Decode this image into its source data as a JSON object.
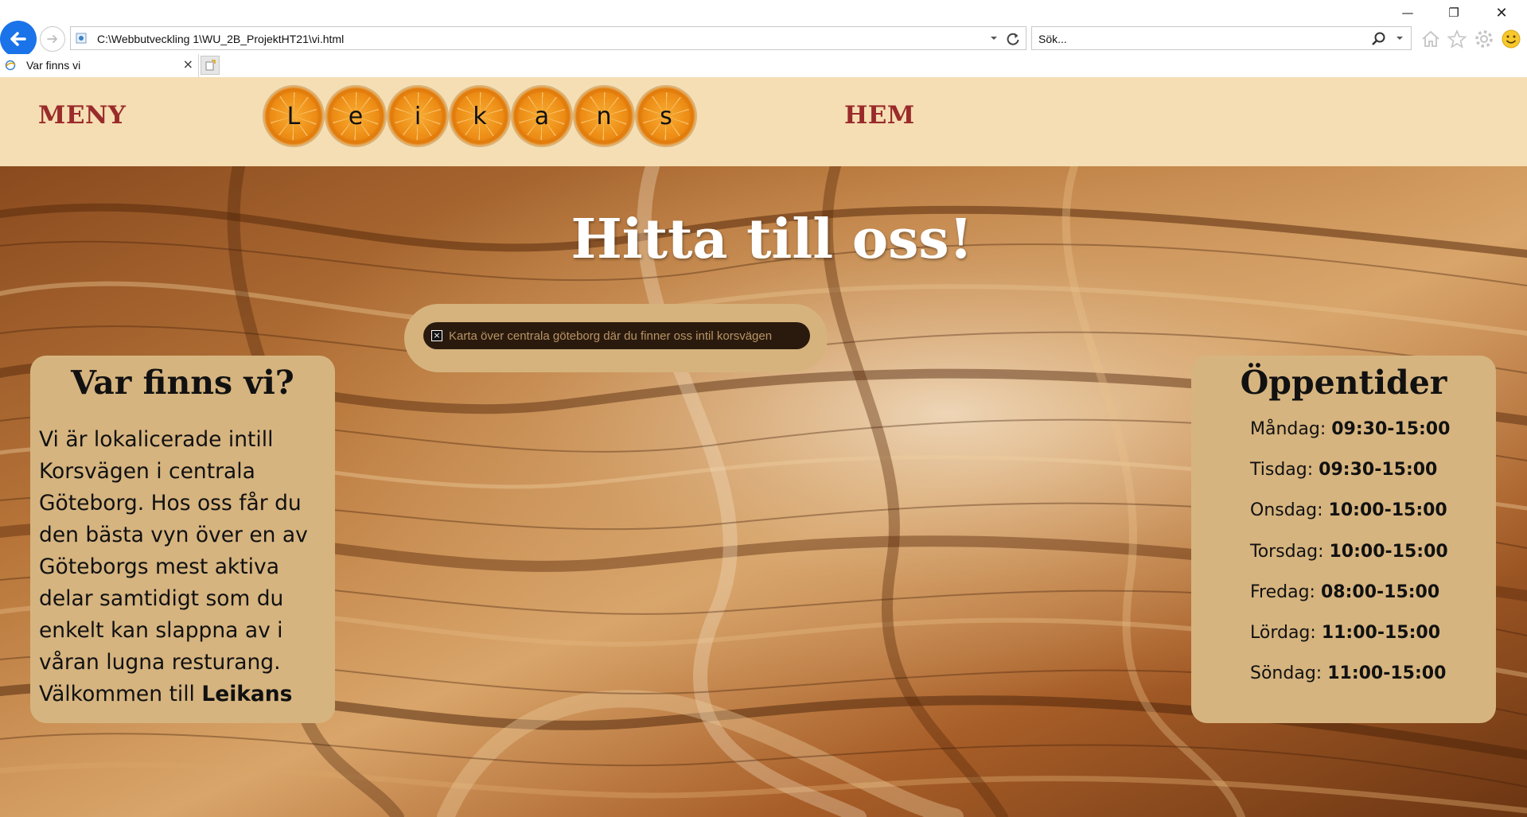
{
  "browser": {
    "address": "C:\\Webbutveckling 1\\WU_2B_ProjektHT21\\vi.html",
    "search_placeholder": "Sök...",
    "tab_title": "Var finns vi"
  },
  "header": {
    "menu_label": "MENY",
    "home_label": "HEM",
    "logo_letters": [
      "L",
      "e",
      "i",
      "k",
      "a",
      "n",
      "s"
    ]
  },
  "hero": {
    "title": "Hitta till oss!",
    "map_alt": "Karta över centrala göteborg där du finner oss intil korsvägen"
  },
  "location_card": {
    "heading": "Var finns vi?",
    "text": "Vi är lokalicerade intill Korsvägen i centrala Göteborg. Hos oss får du den bästa vyn över en av Göteborgs mest aktiva delar samtidigt som du enkelt kan slappna av i våran lugna resturang. Välkommen till ",
    "brand": "Leikans"
  },
  "hours_card": {
    "heading": "Öppentider",
    "days": [
      {
        "day": "Måndag:",
        "time": "09:30-15:00"
      },
      {
        "day": "Tisdag:",
        "time": "09:30-15:00"
      },
      {
        "day": "Onsdag:",
        "time": "10:00-15:00"
      },
      {
        "day": "Torsdag:",
        "time": "10:00-15:00"
      },
      {
        "day": "Fredag:",
        "time": "08:00-15:00"
      },
      {
        "day": "Lördag:",
        "time": "11:00-15:00"
      },
      {
        "day": "Söndag:",
        "time": "11:00-15:00"
      }
    ]
  },
  "colors": {
    "header_bg": "#f5deb3",
    "nav_link": "#9a2b2b",
    "card_bg": "#d6b47f"
  }
}
